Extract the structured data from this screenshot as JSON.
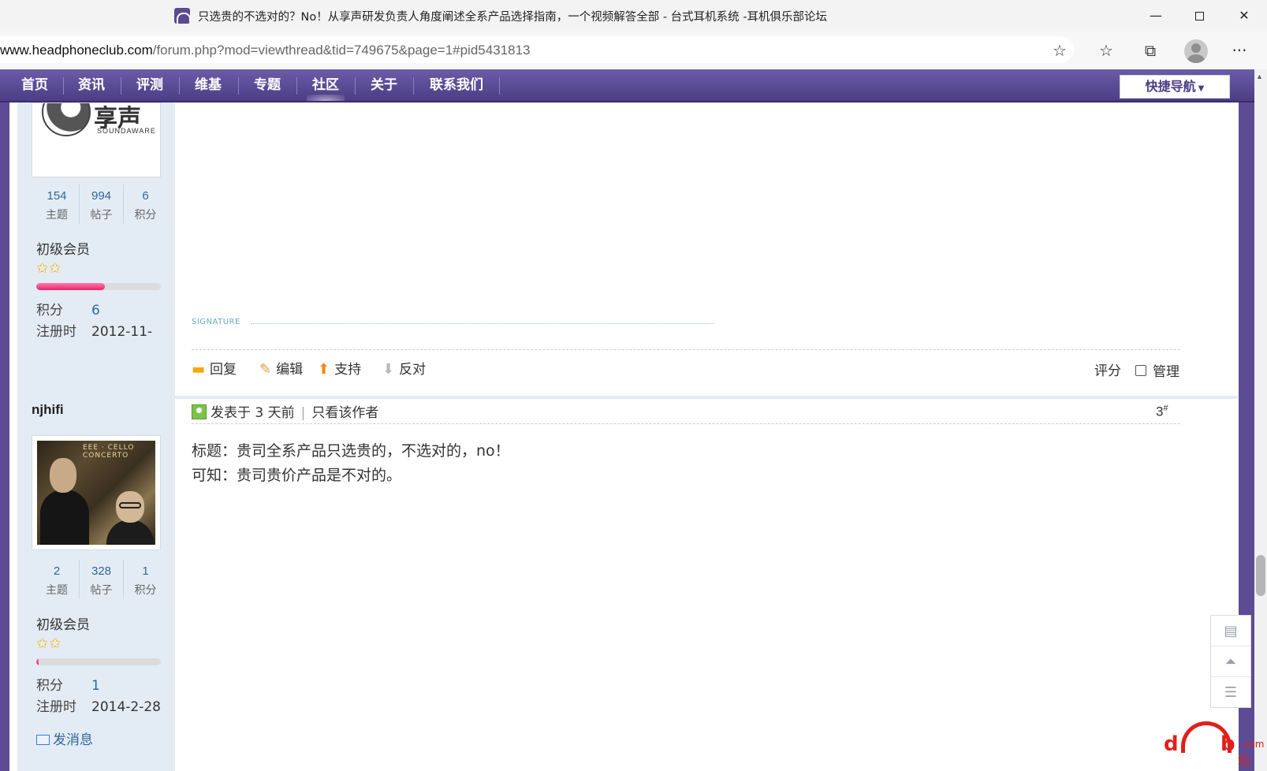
{
  "browser": {
    "tab_title": "只选贵的不选对的？No！从享声研发负责人角度阐述全系产品选择指南，一个视频解答全部 - 台式耳机系统 -耳机俱乐部论坛",
    "url_host": "www.headphoneclub.com",
    "url_path": "/forum.php?mod=viewthread&tid=749675&page=1#pid5431813",
    "window_controls": {
      "minimize": "—",
      "maximize": "",
      "close": "✕"
    },
    "toolbar_icons": [
      "add-favorite-icon",
      "favorites-icon",
      "collections-icon",
      "profile-icon",
      "more-icon"
    ]
  },
  "nav": {
    "items": [
      "首页",
      "资讯",
      "评测",
      "维基",
      "专题",
      "社区",
      "关于",
      "联系我们"
    ],
    "active": "社区",
    "quick_nav": "快捷导航"
  },
  "post_prev": {
    "avatar_brand": "享声",
    "avatar_brand_sub": "SOUNDAWARE",
    "stats": [
      {
        "num": "154",
        "label": "主题"
      },
      {
        "num": "994",
        "label": "帖子"
      },
      {
        "num": "6",
        "label": "积分"
      }
    ],
    "rank": "初级会员",
    "stars": "✩✩",
    "level_progress": 0.55,
    "points_label": "积分",
    "points": "6",
    "reg_label": "注册时",
    "reg_date": "2012-11-",
    "signature_label": "SIGNATURE",
    "actions": {
      "reply": "回复",
      "edit": "编辑",
      "support": "支持",
      "oppose": "反对",
      "rate": "评分",
      "manage": "管理"
    }
  },
  "post": {
    "author": "njhifi",
    "avatar_caption": "EEE · CELLO CONCERTO",
    "stats": [
      {
        "num": "2",
        "label": "主题"
      },
      {
        "num": "328",
        "label": "帖子"
      },
      {
        "num": "1",
        "label": "积分"
      }
    ],
    "rank": "初级会员",
    "stars": "✩✩",
    "level_progress": 0.02,
    "points_label": "积分",
    "points": "1",
    "reg_label": "注册时",
    "reg_date": "2014-2-28",
    "pm": "发消息",
    "posted": "发表于 3 天前",
    "only_author": "只看该作者",
    "floor": "3",
    "floor_mark": "#",
    "lines": [
      "标题：贵司全系产品只选贵的，不选对的，no！",
      "可知：贵司贵价产品是不对的。"
    ]
  },
  "float_tools": [
    "comment-icon",
    "back-to-top-icon",
    "list-icon"
  ],
  "watermark": {
    "left": "d",
    "right": "b",
    "suffix": ".com",
    "sub": "坛"
  }
}
